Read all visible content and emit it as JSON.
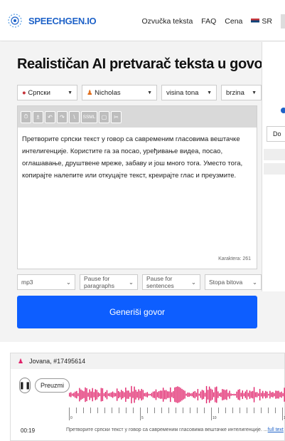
{
  "nav": {
    "logo": "SPEECHGEN.IO",
    "links": [
      "Ozvučka teksta",
      "FAQ",
      "Cena"
    ],
    "lang": "SR"
  },
  "title": "Realističan AI pretvarač teksta u govor",
  "selects": {
    "language": "Српски",
    "voice": "Nicholas",
    "pitch": "visina tona",
    "speed": "brzina"
  },
  "toolbar": [
    "⏱",
    "♗",
    "↶",
    "↷",
    "\\",
    "SSML",
    "▢",
    "✂"
  ],
  "text": "Претворите српски текст у говор са савременим гласовима вештачке интелигенције. Користите га за посао, уређивање видеа, посао, оглашавање, друштвене мреже, забаву и још много тога. Уместо тога, копирајте налепите или откуцајте текст, креирајте глас и преузмите.",
  "counter": "Karaktera: 261",
  "options": {
    "format": "mp3",
    "paragraphs": "Pause for paragraphs",
    "sentences": "Pause for sentences",
    "bitrate": "Stopa bitova"
  },
  "generate": "Generiši govor",
  "side": {
    "btn": "Do"
  },
  "player": {
    "header": "Jovana, #17495614",
    "download": "Preuzmi",
    "time": "00:19",
    "snippet": "Претворите српски текст у говор са савременим гласовима вештачке интелигенције. ...",
    "fulltext": "full text",
    "ticks": [
      "0",
      "5",
      "10",
      "15"
    ],
    "wave_color": "#e0226a"
  }
}
